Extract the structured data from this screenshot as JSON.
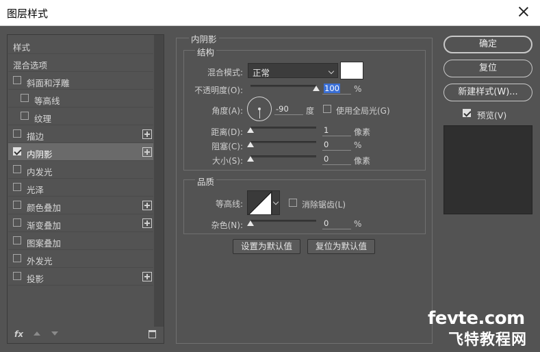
{
  "window": {
    "title": "图层样式"
  },
  "sidebar": {
    "items": [
      {
        "label": "样式",
        "checkbox": false,
        "checked": false,
        "plus": false,
        "indent": false,
        "selected": false
      },
      {
        "label": "混合选项",
        "checkbox": false,
        "checked": false,
        "plus": false,
        "indent": false,
        "selected": false
      },
      {
        "label": "斜面和浮雕",
        "checkbox": true,
        "checked": false,
        "plus": false,
        "indent": false,
        "selected": false
      },
      {
        "label": "等高线",
        "checkbox": true,
        "checked": false,
        "plus": false,
        "indent": true,
        "selected": false
      },
      {
        "label": "纹理",
        "checkbox": true,
        "checked": false,
        "plus": false,
        "indent": true,
        "selected": false
      },
      {
        "label": "描边",
        "checkbox": true,
        "checked": false,
        "plus": true,
        "indent": false,
        "selected": false
      },
      {
        "label": "内阴影",
        "checkbox": true,
        "checked": true,
        "plus": true,
        "indent": false,
        "selected": true
      },
      {
        "label": "内发光",
        "checkbox": true,
        "checked": false,
        "plus": false,
        "indent": false,
        "selected": false
      },
      {
        "label": "光泽",
        "checkbox": true,
        "checked": false,
        "plus": false,
        "indent": false,
        "selected": false
      },
      {
        "label": "颜色叠加",
        "checkbox": true,
        "checked": false,
        "plus": true,
        "indent": false,
        "selected": false
      },
      {
        "label": "渐变叠加",
        "checkbox": true,
        "checked": false,
        "plus": true,
        "indent": false,
        "selected": false
      },
      {
        "label": "图案叠加",
        "checkbox": true,
        "checked": false,
        "plus": false,
        "indent": false,
        "selected": false
      },
      {
        "label": "外发光",
        "checkbox": true,
        "checked": false,
        "plus": false,
        "indent": false,
        "selected": false
      },
      {
        "label": "投影",
        "checkbox": true,
        "checked": false,
        "plus": true,
        "indent": false,
        "selected": false
      }
    ],
    "fx_label": "fx"
  },
  "panel": {
    "title": "内阴影",
    "structure": {
      "title": "结构",
      "blend_mode_label": "混合模式:",
      "blend_mode_value": "正常",
      "opacity_label": "不透明度(O):",
      "opacity_value": "100",
      "opacity_unit": "%",
      "opacity_level": 1.0,
      "angle_label": "角度(A):",
      "angle_value": "-90",
      "angle_unit": "度",
      "global_light_label": "使用全局光(G)",
      "global_light_checked": false,
      "distance_label": "距离(D):",
      "distance_value": "1",
      "distance_unit": "像素",
      "distance_level": 0.0,
      "choke_label": "阻塞(C):",
      "choke_value": "0",
      "choke_unit": "%",
      "choke_level": 0.0,
      "size_label": "大小(S):",
      "size_value": "0",
      "size_unit": "像素",
      "size_level": 0.0
    },
    "quality": {
      "title": "品质",
      "contour_label": "等高线:",
      "anti_alias_label": "消除锯齿(L)",
      "anti_alias_checked": false,
      "noise_label": "杂色(N):",
      "noise_value": "0",
      "noise_unit": "%",
      "noise_level": 0.0
    },
    "make_default_label": "设置为默认值",
    "reset_default_label": "复位为默认值"
  },
  "actions": {
    "ok_label": "确定",
    "reset_label": "复位",
    "new_style_label": "新建样式(W)...",
    "preview_label": "预览(V)",
    "preview_checked": true
  },
  "watermark": {
    "line1": "fevte.com",
    "line2": "飞特教程网"
  },
  "colors": {
    "background": "#535353",
    "highlight": "#3a6fd6",
    "swatch": "#ffffff"
  }
}
